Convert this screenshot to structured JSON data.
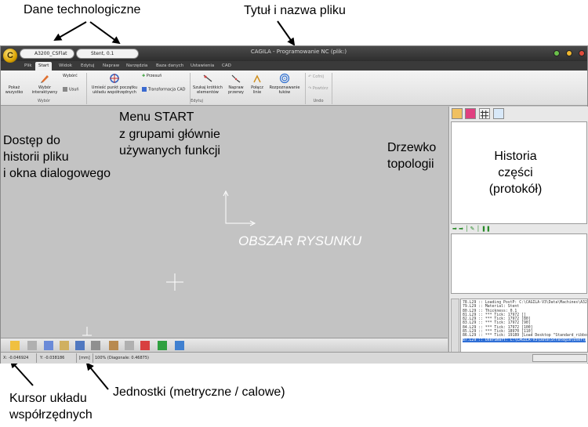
{
  "annotations": {
    "tech_data": "Dane technologiczne",
    "title_file": "Tytuł i nazwa pliku",
    "menu_start_l1": "Menu START",
    "menu_start_l2": "z grupami głównie",
    "menu_start_l3": "używanych funkcji",
    "access_l1": "Dostęp do",
    "access_l2": "historii pliku",
    "access_l3": "i okna dialogowego",
    "tree_l1": "Drzewko",
    "tree_l2": "topologii",
    "history_l1": "Historia",
    "history_l2": "części",
    "history_l3": "(protokół)",
    "cursor_l1": "Kursor układu",
    "cursor_l2": "współrzędnych",
    "units": "Jednostki (metryczne / calowe)"
  },
  "window": {
    "title": "CAGILA - Programowanie NC (plik:)",
    "orb_letter": "C",
    "machine_field": "A3200_CSFlat",
    "material_field": "Stent, 0.1"
  },
  "tabs": [
    "Plik",
    "Start",
    "Widok",
    "Edytuj",
    "Napraw",
    "Narzędzia",
    "Baza danych",
    "Ustawienia",
    "CAD"
  ],
  "ribbon": {
    "show_all": "Pokaż wszystko",
    "interactive_select": "Wybór interaktywny",
    "select_back": "Wybórć",
    "delete": "Usuń",
    "group_select": "Wybór",
    "place_origin": "Umieść punkt początku układu współrzędnych",
    "move": "Przesuń",
    "cad_transform": "Transformacja CAD",
    "search_short": "Szukaj krótkich elementów",
    "fix_gaps": "Napraw przerwy",
    "join_lines": "Połącz linie",
    "recognize_arcs": "Rozpoznawanie łuków",
    "group_edit": "Edytuj",
    "undo": "Cofnij",
    "redo": "Powtórz",
    "group_undo": "Undo"
  },
  "drawing": {
    "label": "OBSZAR RYSUNKU"
  },
  "log": [
    "78.L29 :: Loading PostP: C:\\CAGILA-V3\\Data\\Machines\\A3200_CS\\",
    "79.L29 :: Material: Stent",
    "80.L29 :: Thickness: 0.1",
    "81.L29 :: *** Tick: 17972 []",
    "82.L29 :: *** Tick: 17972 [80]",
    "83.L29 :: *** Tick: 17972 [90]",
    "84.L29 :: *** Tick: 17972 [100]",
    "85.L29 :: *** Tick: 18970 [110]",
    "86.L29 :: *** Tick: 19189 [Load Desktop \"Standard_ribbon\" end]",
    "87.L29 :: UserSmart: C:\\CAGILA-V3\\Data\\Strategie\\User\\Default\\"
  ],
  "status": {
    "x": "X: -0.046924",
    "y": "Y: -0.038186",
    "units": "[mm]",
    "zoom": "100% (Diagonale: 0.46875)"
  }
}
